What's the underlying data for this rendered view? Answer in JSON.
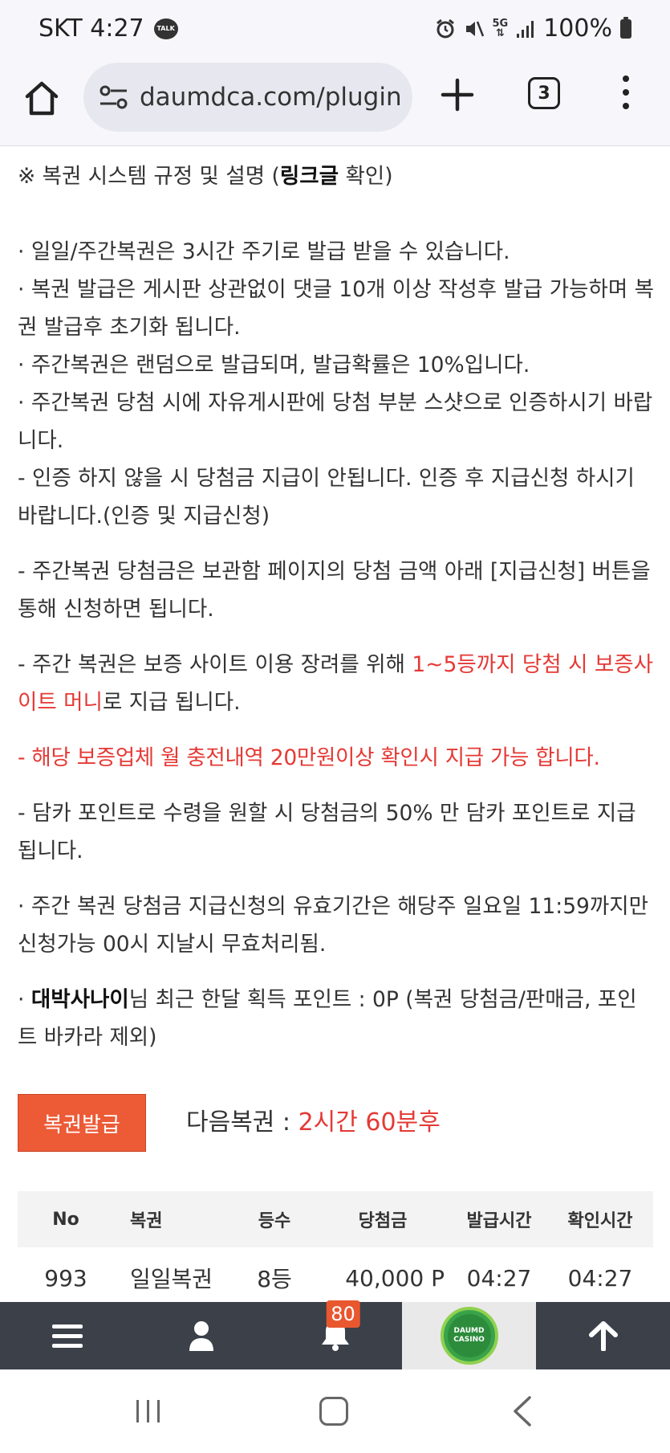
{
  "status_bar": {
    "carrier_time": "SKT 4:27",
    "talk_badge": "TALK",
    "network": "5G",
    "battery": "100%"
  },
  "browser": {
    "url": "daumdca.com/plugin",
    "tab_count": "3"
  },
  "content": {
    "heading_prefix": "※ 복권 시스템 규정 및 설명 (",
    "heading_link": "링크글",
    "heading_suffix": " 확인)",
    "rule1": " · 일일/주간복권은 3시간 주기로 발급 받을 수 있습니다.",
    "rule2": " · 복권 발급은 게시판 상관없이 댓글 10개 이상 작성후 발급 가능하며 복권 발급후 초기화 됩니다.",
    "rule3": " · 주간복권은 랜덤으로 발급되며, 발급확률은 10%입니다.",
    "rule4": " · 주간복권 당첨 시에 자유게시판에 당첨 부분 스샷으로 인증하시기 바랍니다.",
    "rule5": "  - 인증 하지 않을 시 당첨금 지급이 안됩니다. 인증 후 지급신청 하시기 바랍니다.(인증 및 지급신청)",
    "rule6": "  - 주간복권 당첨금은 보관함 페이지의 당첨 금액 아래 [지급신청] 버튼을 통해 신청하면 됩니다.",
    "rule7_prefix": "  - 주간 복권은 보증 사이트 이용 장려를 위해 ",
    "rule7_red": "1~5등까지 당첨 시 보증사이트 머니",
    "rule7_suffix": "로 지급 됩니다.",
    "rule8_prefix": "  - ",
    "rule8_red": "해당 보증업체 월 충전내역 20만원이상 확인시 지급 가능 합니다.",
    "rule9": "  - 담카 포인트로 수령을 원할 시 당첨금의 50% 만 담카 포인트로 지급 됩니다.",
    "rule10": " · 주간 복권 당첨금 지급신청의 유효기간은 해당주 일요일 11:59까지만 신청가능 00시 지날시 무효처리됨.",
    "rule11_prefix": " · ",
    "rule11_user": "대박사나이",
    "rule11_suffix": "님 최근 한달 획득 포인트 : 0P (복권 당첨금/판매금, 포인트 바카라 제외)"
  },
  "issue": {
    "button_label": "복권발급",
    "next_label": "다음복권 : ",
    "next_value": "2시간 60분후"
  },
  "table": {
    "headers": [
      "No",
      "복권",
      "등수",
      "당첨금",
      "발급시간",
      "확인시간"
    ],
    "rows": [
      [
        "993",
        "일일복권",
        "8등",
        "40,000 P",
        "04:27",
        "04:27"
      ]
    ]
  },
  "site_nav": {
    "notification_count": "80",
    "logo_text_top": "DAUMD",
    "logo_text_bottom": "CASINO"
  },
  "colors": {
    "accent_red": "#e53935",
    "issue_button": "#ec5a36",
    "nav_bg": "#3b4049"
  }
}
